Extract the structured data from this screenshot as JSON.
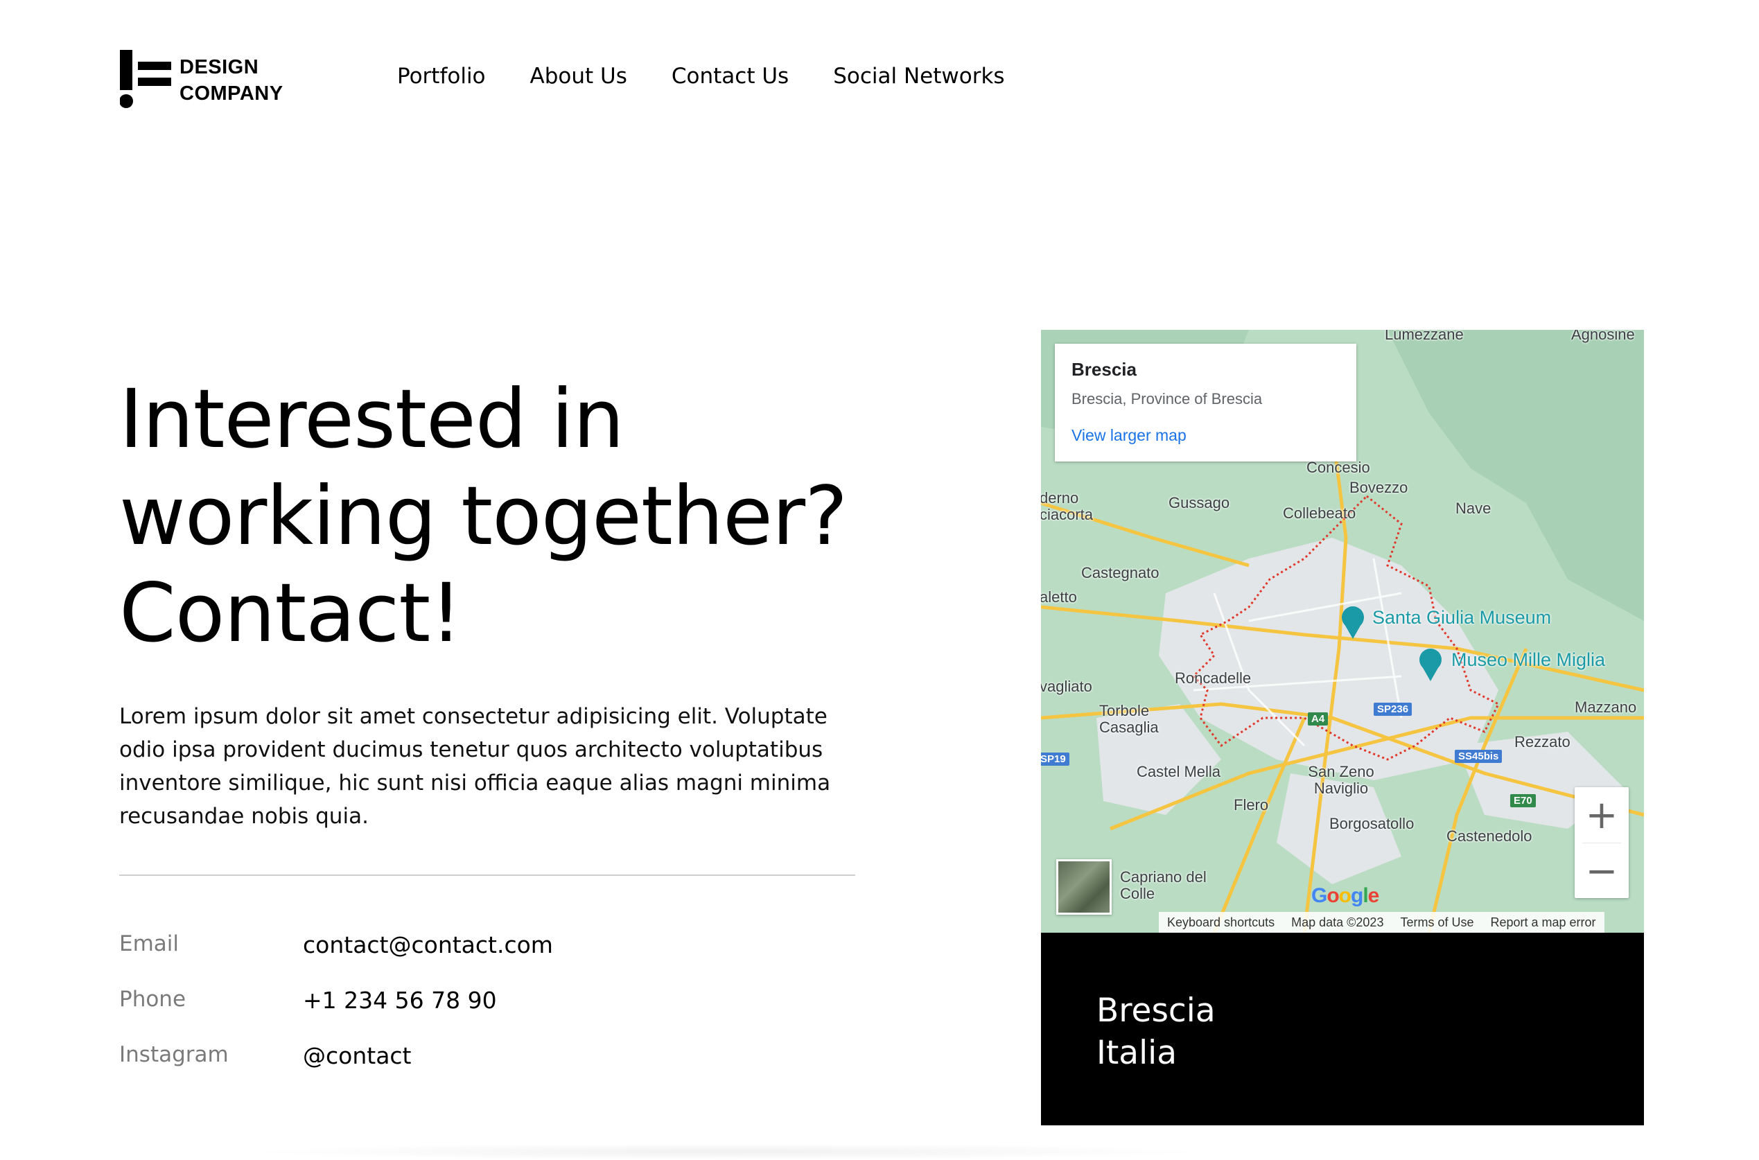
{
  "header": {
    "logo_line1": "DESIGN",
    "logo_line2": "COMPANY",
    "nav": [
      "Portfolio",
      "About Us",
      "Contact Us",
      "Social Networks"
    ]
  },
  "hero": {
    "headline_lines": [
      "Interested in",
      "working together?",
      "Contact!"
    ],
    "body": "Lorem ipsum dolor sit amet consectetur adipisicing elit. Voluptate odio ipsa provident ducimus tenetur quos architecto voluptatibus inventore similique, hic sunt nisi officia eaque alias magni minima recusandae nobis quia."
  },
  "contacts": [
    {
      "label": "Email",
      "value": "contact@contact.com"
    },
    {
      "label": "Phone",
      "value": "+1 234 56 78 90"
    },
    {
      "label": "Instagram",
      "value": "@contact"
    }
  ],
  "map": {
    "card_title": "Brescia",
    "card_subtitle": "Brescia, Province of Brescia",
    "card_link": "View larger map",
    "places": [
      "Lumezzane",
      "Agnosine",
      "Concesio",
      "Bovezzo",
      "Gussago",
      "Collebeato",
      "Nave",
      "Castegnato",
      "Santa Giulia Museum",
      "Museo Mille Miglia",
      "Roncadelle",
      "Torbole Casaglia",
      "Mazzano",
      "Rezzato",
      "Castel Mella",
      "San Zeno Naviglio",
      "Flero",
      "Borgosatollo",
      "Castenedolo",
      "Capriano del Colle",
      "derno",
      "ciacorta",
      "aletto",
      "vagliato"
    ],
    "road_shields": [
      "SP19",
      "A4",
      "SP236",
      "SS45bis",
      "E70"
    ],
    "zoom_in": "+",
    "zoom_out": "−",
    "google_logo": "Google",
    "attribution": [
      "Keyboard shortcuts",
      "Map data ©2023",
      "Terms of Use",
      "Report a map error"
    ],
    "colors": {
      "land": "#b9dcc3",
      "urban": "#e8eaed",
      "roads": "#f5c542",
      "boundary": "#e0392b",
      "poi": "#1a9aa6"
    }
  },
  "address": {
    "line1": "Brescia",
    "line2": "Italia"
  }
}
